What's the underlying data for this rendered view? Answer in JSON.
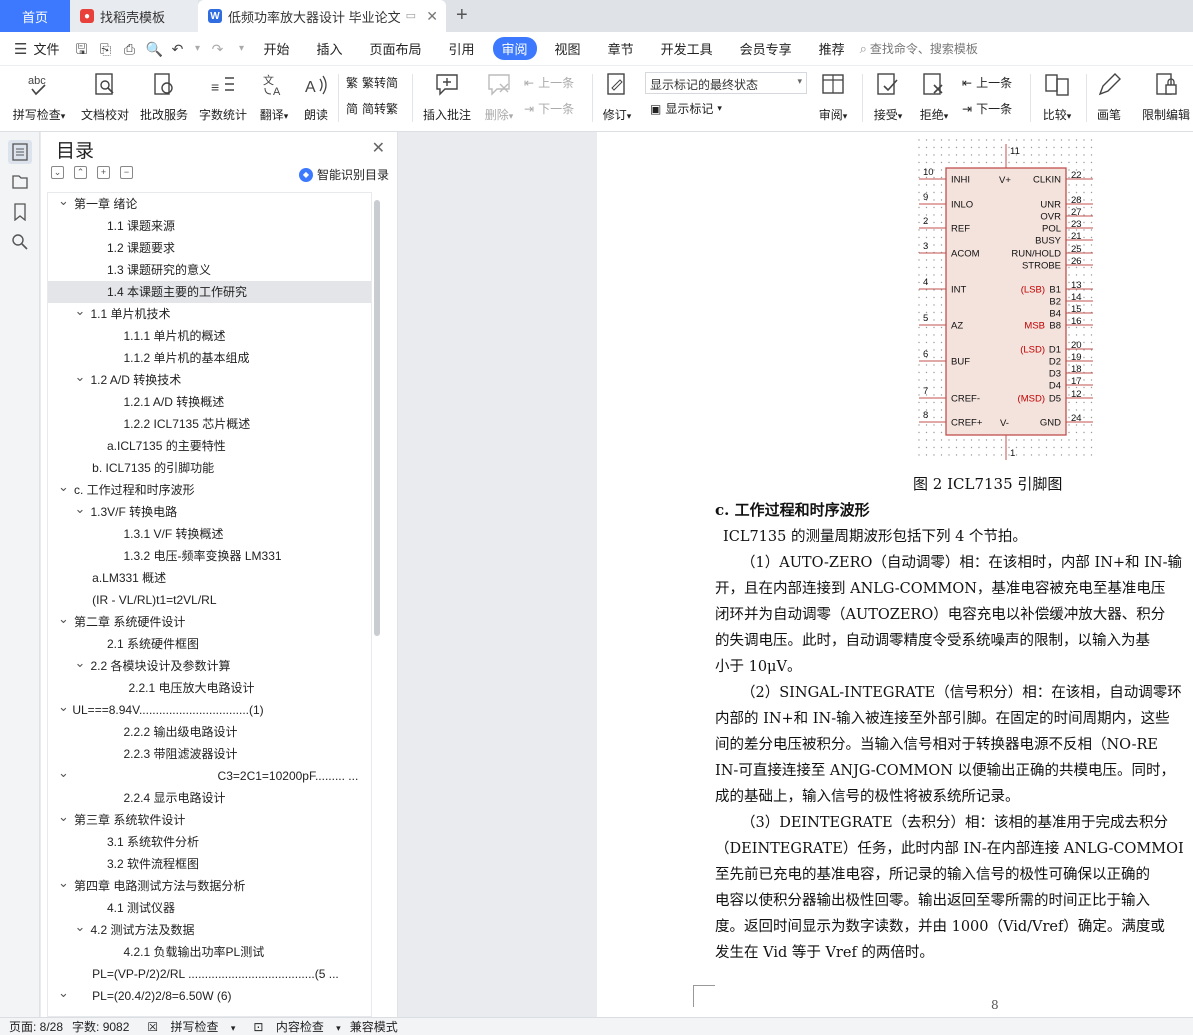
{
  "tabs": {
    "home": "首页",
    "template": "找稻壳模板",
    "doc": "低频功率放大器设计 毕业论文"
  },
  "menu": {
    "file": "文件",
    "items": [
      "开始",
      "插入",
      "页面布局",
      "引用",
      "审阅",
      "视图",
      "章节",
      "开发工具",
      "会员专享",
      "推荐"
    ],
    "search": "查找命令、搜索模板"
  },
  "ribbon": {
    "spell": "拼写检查",
    "proof": "文档校对",
    "batch": "批改服务",
    "count": "字数统计",
    "translate": "翻译",
    "read": "朗读",
    "trad": "繁转简",
    "simp": "简转繁",
    "insert_comment": "插入批注",
    "delete": "删除",
    "prev": "上一条",
    "next": "下一条",
    "revise": "修订",
    "markup_state": "显示标记的最终状态",
    "show_markup": "显示标记",
    "review": "审阅",
    "accept": "接受",
    "reject": "拒绝",
    "prev2": "上一条",
    "next2": "下一条",
    "compare": "比较",
    "pen": "画笔",
    "restrict": "限制编辑"
  },
  "toc": {
    "title": "目录",
    "smart": "智能识别目录",
    "items": [
      {
        "text": "第一章 绪论",
        "indent": 0,
        "arrow": "v"
      },
      {
        "text": "1.1 课题来源",
        "indent": 2
      },
      {
        "text": "1.2 课题要求",
        "indent": 2
      },
      {
        "text": "1.3 课题研究的意义",
        "indent": 2
      },
      {
        "text": "1.4 本课题主要的工作研究",
        "indent": 2,
        "sel": true
      },
      {
        "text": "1.1 单片机技术",
        "indent": 1,
        "arrow": "v"
      },
      {
        "text": "1.1.1 单片机的概述",
        "indent": 3
      },
      {
        "text": "1.1.2 单片机的基本组成",
        "indent": 3
      },
      {
        "text": "1.2 A/D 转换技术",
        "indent": 1,
        "arrow": "v"
      },
      {
        "text": "1.2.1 A/D 转换概述",
        "indent": 3
      },
      {
        "text": "1.2.2 ICL7135 芯片概述",
        "indent": 3
      },
      {
        "text": "a.ICL7135 的主要特性",
        "indent": 2
      },
      {
        "text": "b. ICL7135 的引脚功能",
        "indent": 1.1
      },
      {
        "text": "c.  工作过程和时序波形",
        "indent": 0,
        "arrow": "v"
      },
      {
        "text": "1.3V/F 转换电路",
        "indent": 1,
        "arrow": "v"
      },
      {
        "text": "1.3.1 V/F 转换概述",
        "indent": 3
      },
      {
        "text": "1.3.2  电压-频率变换器 LM331",
        "indent": 3
      },
      {
        "text": "a.LM331  概述",
        "indent": 1.1
      },
      {
        "text": "(IR - VL/RL)t1=t2VL/RL",
        "indent": 1.1
      },
      {
        "text": "第二章  系统硬件设计",
        "indent": 0,
        "arrow": "v"
      },
      {
        "text": "2.1  系统硬件框图",
        "indent": 2
      },
      {
        "text": "2.2  各模块设计及参数计算",
        "indent": 1,
        "arrow": "v"
      },
      {
        "text": "2.2.1  电压放大电路设计",
        "indent": 3.3
      },
      {
        "text": "UL===8.94V.................................(1)",
        "indent": -0.1,
        "arrow": "v"
      },
      {
        "text": "2.2.2  输出级电路设计",
        "indent": 3
      },
      {
        "text": "2.2.3  带阻滤波器设计",
        "indent": 3
      },
      {
        "text": "C3=2C1=10200pF.........  ...",
        "indent": 8.7,
        "arrow": "v0"
      },
      {
        "text": "2.2.4  显示电路设计",
        "indent": 3
      },
      {
        "text": "第三章   系统软件设计",
        "indent": 0,
        "arrow": "v"
      },
      {
        "text": "3.1  系统软件分析",
        "indent": 2
      },
      {
        "text": "3.2  软件流程框图",
        "indent": 2
      },
      {
        "text": "第四章   电路测试方法与数据分析",
        "indent": 0,
        "arrow": "v"
      },
      {
        "text": "4.1  测试仪器",
        "indent": 2
      },
      {
        "text": "4.2  测试方法及数据",
        "indent": 1,
        "arrow": "v"
      },
      {
        "text": "4.2.1  负载输出功率PL测试",
        "indent": 3
      },
      {
        "text": "PL=(VP-P/2)2/RL ......................................(5 ...",
        "indent": 1.1
      },
      {
        "text": "PL=(20.4/2)2/8=6.50W                               (6)",
        "indent": 1.1,
        "arrow": "v0"
      }
    ]
  },
  "chip": {
    "left_pins": [
      {
        "num": "10",
        "name": "INHI"
      },
      {
        "num": "9",
        "name": "INLO"
      },
      {
        "num": "2",
        "name": "REF"
      },
      {
        "num": "3",
        "name": "ACOM"
      },
      {
        "num": "4",
        "name": "INT"
      },
      {
        "num": "5",
        "name": "AZ"
      },
      {
        "num": "6",
        "name": "BUF"
      },
      {
        "num": "7",
        "name": "CREF-"
      },
      {
        "num": "8",
        "name": "CREF+"
      }
    ],
    "right_pins": [
      {
        "num": "22",
        "name": "CLKIN"
      },
      {
        "num": "28",
        "name": "UNR"
      },
      {
        "num": "27",
        "name": "OVR"
      },
      {
        "num": "23",
        "name": "POL"
      },
      {
        "num": "21",
        "name": "BUSY"
      },
      {
        "num": "25",
        "name": "RUN/HOLD"
      },
      {
        "num": "26",
        "name": "STROBE"
      },
      {
        "num": "13",
        "name": "B1",
        "prefix": "(LSB)"
      },
      {
        "num": "14",
        "name": "B2"
      },
      {
        "num": "15",
        "name": "B4"
      },
      {
        "num": "16",
        "name": "B8",
        "prefix": "MSB"
      },
      {
        "num": "20",
        "name": "D1",
        "prefix": "(LSD)"
      },
      {
        "num": "19",
        "name": "D2"
      },
      {
        "num": "18",
        "name": "D3"
      },
      {
        "num": "17",
        "name": "D4"
      },
      {
        "num": "12",
        "name": "D5",
        "prefix": "(MSD)"
      },
      {
        "num": "24",
        "name": "GND"
      }
    ],
    "top_pin": {
      "num": "11",
      "name": "V+"
    },
    "bottom_pin": {
      "num": "1",
      "name": "V-"
    },
    "caption": "图 2    ICL7135 引脚图"
  },
  "doc": {
    "heading": "c.  工作过程和时序波形",
    "lines": [
      "ICL7135 的测量周期波形包括下列 4 个节拍。",
      "（1）AUTO-ZERO（自动调零）相：在该相时，内部 IN+和 IN-输",
      "开，且在内部连接到 ANLG-COMMON，基准电容被充电至基准电压",
      "闭环并为自动调零（AUTOZERO）电容充电以补偿缓冲放大器、积分",
      "的失调电压。此时，自动调零精度令受系统噪声的限制，以输入为基",
      "小于 10μV。",
      "（2）SINGAL-INTEGRATE（信号积分）相：在该相，自动调零环",
      "内部的 IN+和 IN-输入被连接至外部引脚。在固定的时间周期内，这些",
      "间的差分电压被积分。当输入信号相对于转换器电源不反相（NO-RE",
      "IN-可直接连接至 ANJG-COMMON 以便输出正确的共模电压。同时，",
      "成的基础上，输入信号的极性将被系统所记录。",
      "（3）DEINTEGRATE（去积分）相：该相的基准用于完成去积分",
      "（DEINTEGRATE）任务，此时内部 IN-在内部连接 ANLG-COMMOI",
      "至先前已充电的基准电容，所记录的输入信号的极性可确保以正确的",
      "电容以使积分器输出极性回零。输出返回至零所需的时间正比于输入",
      "度。返回时间显示为数字读数，并由 1000（Vid/Vref）确定。满度或",
      "发生在 Vid 等于 Vref 的两倍时。"
    ],
    "page_num": "8"
  },
  "status": {
    "page": "页面: 8/28",
    "words": "字数: 9082",
    "spell": "拼写检查",
    "content": "内容检查",
    "compat": "兼容模式"
  },
  "colors": {
    "accent": "#3c79ff",
    "chip_fill": "#f4e2dc",
    "chip_border": "#c0504d",
    "pin_red": "#c00000"
  }
}
